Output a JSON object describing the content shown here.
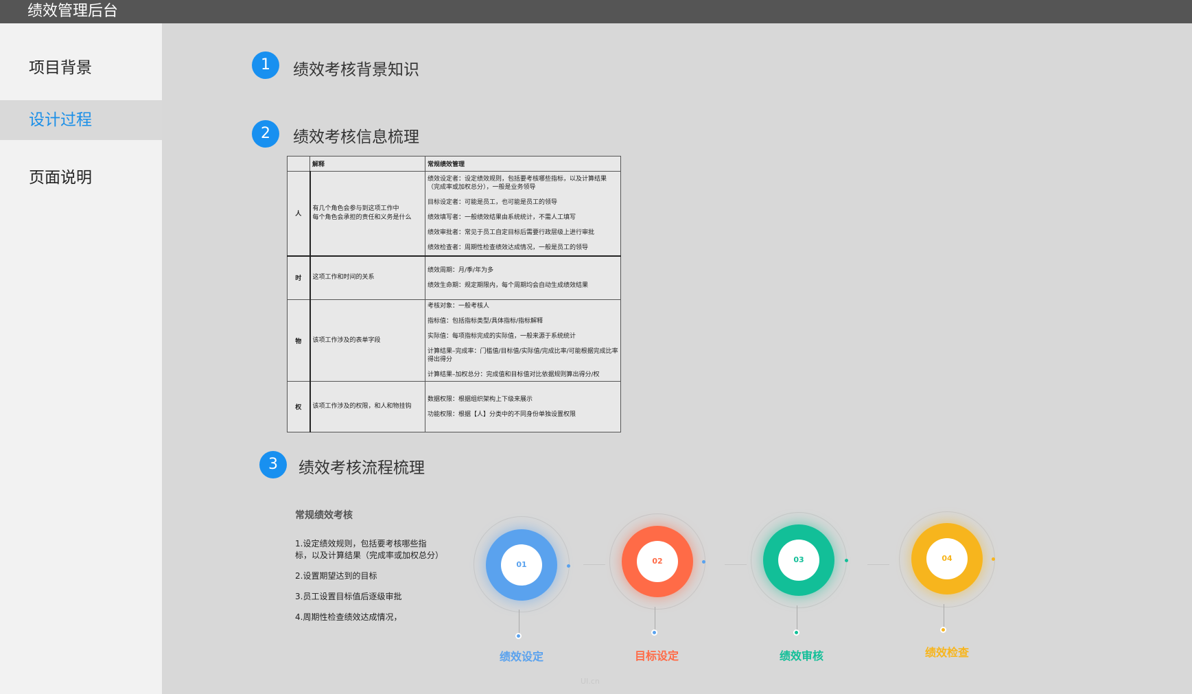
{
  "app": {
    "title": "绩效管理后台"
  },
  "sidebar": {
    "items": [
      {
        "label": "项目背景",
        "active": false
      },
      {
        "label": "设计过程",
        "active": true
      },
      {
        "label": "页面说明",
        "active": false
      }
    ]
  },
  "sections": [
    {
      "number": "1",
      "title": "绩效考核背景知识"
    },
    {
      "number": "2",
      "title": "绩效考核信息梳理"
    },
    {
      "number": "3",
      "title": "绩效考核流程梳理"
    }
  ],
  "info_table": {
    "headers": [
      "",
      "解释",
      "常规绩效管理"
    ],
    "rows": [
      {
        "dimension": "人",
        "desc_lines": [
          "有几个角色会参与到这项工作中",
          "每个角色会承担的责任和义务是什么"
        ],
        "details": [
          "绩效设定者：设定绩效规则，包括要考核哪些指标，以及计算结果（完成率或加权总分），一般是业务领导",
          "目标设定者：可能是员工，也可能是员工的领导",
          "绩效填写者：一般绩效结果由系统统计，不需人工填写",
          "绩效审批者：常见于员工自定目标后需要行政层级上进行审批",
          "绩效检查者：周期性检查绩效达成情况，一般是员工的领导"
        ]
      },
      {
        "dimension": "时",
        "desc_lines": [
          "这项工作和时间的关系"
        ],
        "details": [
          "绩效周期：月/季/年为多",
          "绩效生命期：规定期限内，每个周期均会自动生成绩效结果"
        ]
      },
      {
        "dimension": "物",
        "desc_lines": [
          "该项工作涉及的表单字段"
        ],
        "details": [
          "考核对象：一般考核人",
          "指标值：包括指标类型/具体指标/指标解释",
          "实际值：每项指标完成的实际值，一般来源于系统统计",
          "计算结果–完成率：门槛值/目标值/实际值/完成比率/可能根据完成比率得出得分",
          "计算结果–加权总分：完成值和目标值对比依据规则算出得分/权"
        ]
      },
      {
        "dimension": "权",
        "desc_lines": [
          "该项工作涉及的权限，和人和物挂钩"
        ],
        "details": [
          "数据权限：根据组织架构上下级来展示",
          "功能权限：根据【人】分类中的不同身份单独设置权限"
        ]
      }
    ]
  },
  "flow": {
    "subtitle": "常规绩效考核",
    "steps": [
      "1.设定绩效规则，包括要考核哪些指标，以及计算结果（完成率或加权总分）",
      "2.设置期望达到的目标",
      "3.员工设置目标值后逐级审批",
      "4.周期性检查绩效达成情况，"
    ],
    "stages": [
      {
        "number": "01",
        "label": "绩效设定",
        "color": "#5aa2ee"
      },
      {
        "number": "02",
        "label": "目标设定",
        "color": "#ff6b47"
      },
      {
        "number": "03",
        "label": "绩效审核",
        "color": "#12bf98"
      },
      {
        "number": "04",
        "label": "绩效检查",
        "color": "#f7b51d"
      }
    ]
  },
  "watermark": "UI.cn"
}
